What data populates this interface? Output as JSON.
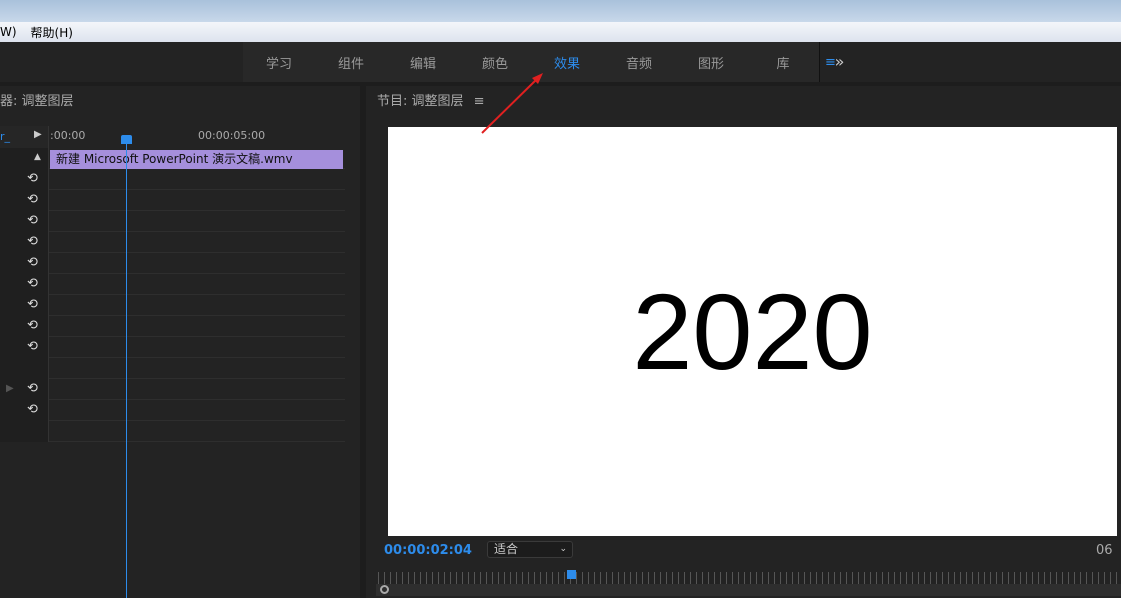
{
  "menubar": {
    "items": [
      "W)",
      "帮助(H)"
    ]
  },
  "workspaces": {
    "tabs": [
      "学习",
      "组件",
      "编辑",
      "颜色",
      "效果",
      "音频",
      "图形",
      "库"
    ],
    "active": "效果",
    "menu_icon": "≡",
    "more": "»"
  },
  "left_panel": {
    "title": "器: 调整图层",
    "seq_label": "r_",
    "ruler_start": ":00:00",
    "ruler_mid": "00:00:05:00",
    "clip_name": "新建 Microsoft PowerPoint 演示文稿.wmv",
    "reset_icon": "⟲"
  },
  "program": {
    "title": "节目: 调整图层",
    "menu_icon": "≡",
    "frame_text": "2020",
    "timecode": "00:00:02:04",
    "fit": "适合",
    "end_timecode": "06"
  },
  "colors": {
    "accent": "#2d8ceb",
    "clip": "#a58fdc",
    "annotation": "#e02020"
  }
}
